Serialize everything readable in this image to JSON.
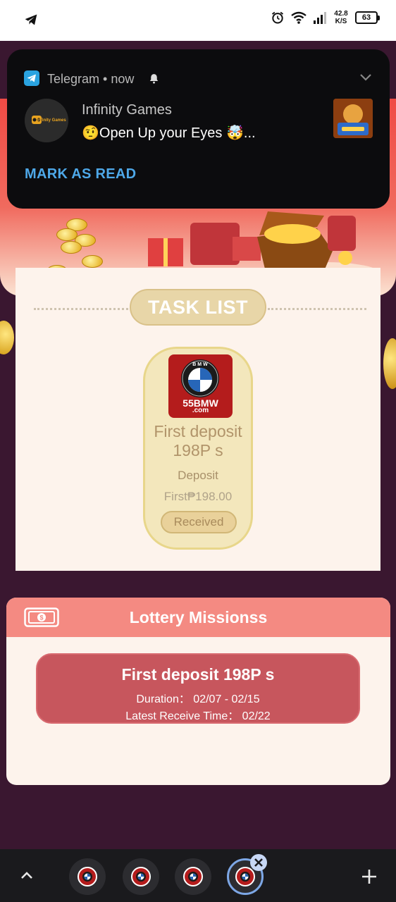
{
  "status_bar": {
    "net_speed_value": "42.8",
    "net_speed_unit": "K/S",
    "battery": "63"
  },
  "notification": {
    "app_name": "Telegram • now",
    "sender": "Infinity Games",
    "message": "🤨Open Up your Eyes 🤯...",
    "avatar_caption": "Infinity Games",
    "mark_read_label": "MARK AS READ"
  },
  "task_list": {
    "title": "TASK LIST",
    "card": {
      "logo_ring_text": "B M W",
      "logo_brand": "55BMW",
      "logo_domain": ".com",
      "title": "First deposit 198P s",
      "type": "Deposit",
      "amount": "First₱198.00",
      "button_label": "Received"
    }
  },
  "lottery": {
    "title": "Lottery Missionss",
    "mission": {
      "name": "First deposit 198P s",
      "duration": "Duration： 02/07 - 02/15",
      "receive_time": "Latest Receive Time： 02/22"
    }
  },
  "colors": {
    "accent_red": "#ef4b45",
    "lottery_header": "#f48a82",
    "mission_card": "#c7565d",
    "telegram_blue": "#4ea8e8"
  },
  "icons": [
    "telegram-icon",
    "alarm-icon",
    "wifi-icon",
    "signal-icon",
    "bell-icon",
    "chevron-down-icon",
    "money-icon",
    "up-arrow-icon",
    "plus-icon",
    "close-icon"
  ]
}
